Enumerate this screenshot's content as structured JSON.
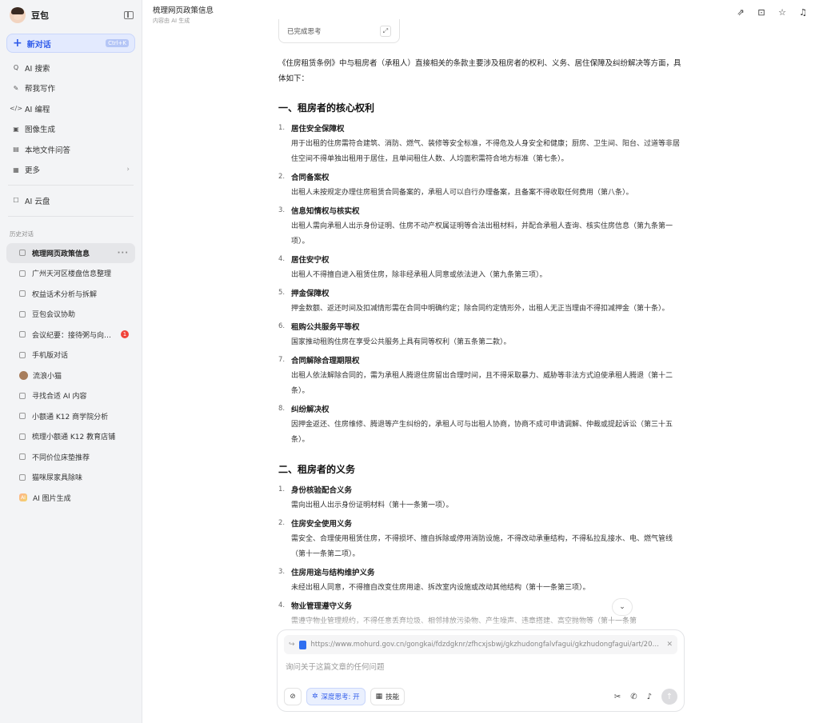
{
  "sidebar": {
    "app_name": "豆包",
    "new_chat": {
      "label": "新对话",
      "shortcut": "Ctrl+K"
    },
    "nav": [
      {
        "icon": "ai-search-icon",
        "glyph": "Q",
        "label": "AI 搜索"
      },
      {
        "icon": "writing-icon",
        "glyph": "✎",
        "label": "帮我写作"
      },
      {
        "icon": "code-icon",
        "glyph": "</>",
        "label": "AI 编程"
      },
      {
        "icon": "image-icon",
        "glyph": "▣",
        "label": "图像生成"
      },
      {
        "icon": "file-qa-icon",
        "glyph": "▤",
        "label": "本地文件问答"
      },
      {
        "icon": "more-grid-icon",
        "glyph": "▦",
        "label": "更多"
      }
    ],
    "cloud": {
      "glyph": "☐",
      "label": "AI 云盘"
    },
    "history_title": "历史对话",
    "history": [
      {
        "label": "梳理网页政策信息",
        "active": true,
        "more": "···"
      },
      {
        "label": "广州天河区楼盘信息整理"
      },
      {
        "label": "权益话术分析与拆解"
      },
      {
        "label": "豆包会议协助"
      },
      {
        "label": "会议纪要：接待粥与向问题...",
        "badge": "1"
      },
      {
        "label": "手机版对话"
      },
      {
        "label": "流浪小猫",
        "avatar": true
      },
      {
        "label": "寻找合适 AI 内容"
      },
      {
        "label": "小额通 K12 商学院分析"
      },
      {
        "label": "梳理小额通 K12 教育店铺"
      },
      {
        "label": "不同价位床垫推荐"
      },
      {
        "label": "猫咪尿家具除味"
      },
      {
        "label": "AI 图片生成",
        "img": true
      }
    ]
  },
  "header": {
    "title": "梳理网页政策信息",
    "subtitle": "内容由 AI 生成",
    "actions": [
      {
        "icon": "share-icon",
        "glyph": "⇗"
      },
      {
        "icon": "save-icon",
        "glyph": "⊡"
      },
      {
        "icon": "star-icon",
        "glyph": "☆"
      },
      {
        "icon": "notification-icon",
        "glyph": "♫"
      }
    ]
  },
  "content": {
    "think_card": {
      "label": "已完成思考",
      "expand_glyph": "⤢"
    },
    "intro": "《住房租赁条例》中与租房者（承租人）直接相关的条款主要涉及租房者的权利、义务、居住保障及纠纷解决等方面，具体如下：",
    "sections": [
      {
        "heading": "一、租房者的核心权利",
        "items": [
          {
            "num": "1.",
            "title": "居住安全保障权",
            "desc": "用于出租的住房需符合建筑、消防、燃气、装修等安全标准，不得危及人身安全和健康；厨房、卫生间、阳台、过道等非居住空间不得单独出租用于居住，且单间租住人数、人均面积需符合地方标准（第七条）。"
          },
          {
            "num": "2.",
            "title": "合同备案权",
            "desc": "出租人未按规定办理住房租赁合同备案的，承租人可以自行办理备案，且备案不得收取任何费用（第八条）。"
          },
          {
            "num": "3.",
            "title": "信息知情权与核实权",
            "desc": "出租人需向承租人出示身份证明、住房不动产权属证明等合法出租材料，并配合承租人查询、核实住房信息（第九条第一项）。"
          },
          {
            "num": "4.",
            "title": "居住安宁权",
            "desc": "出租人不得擅自进入租赁住房，除非经承租人同意或依法进入（第九条第三项）。"
          },
          {
            "num": "5.",
            "title": "押金保障权",
            "desc": "押金数额、返还时间及扣减情形需在合同中明确约定；除合同约定情形外，出租人无正当理由不得扣减押金（第十条）。"
          },
          {
            "num": "6.",
            "title": "租购公共服务平等权",
            "desc": "国家推动租购住房在享受公共服务上具有同等权利（第五条第二款）。"
          },
          {
            "num": "7.",
            "title": "合同解除合理期限权",
            "desc": "出租人依法解除合同的，需为承租人腾退住房留出合理时间，且不得采取暴力、威胁等非法方式迫使承租人腾退（第十二条）。"
          },
          {
            "num": "8.",
            "title": "纠纷解决权",
            "desc": "因押金返还、住房维修、腾退等产生纠纷的，承租人可与出租人协商，协商不成可申请调解、仲裁或提起诉讼（第三十五条）。"
          }
        ]
      },
      {
        "heading": "二、租房者的义务",
        "items": [
          {
            "num": "1.",
            "title": "身份核验配合义务",
            "desc": "需向出租人出示身份证明材料（第十一条第一项）。"
          },
          {
            "num": "2.",
            "title": "住房安全使用义务",
            "desc": "需安全、合理使用租赁住房，不得损坏、擅自拆除或停用消防设施，不得改动承重结构，不得私拉乱接水、电、燃气管线（第十一条第二项）。"
          },
          {
            "num": "3.",
            "title": "住房用途与结构维护义务",
            "desc": "未经出租人同意，不得擅自改变住房用途、拆改室内设施或改动其他结构（第十一条第三项）。"
          },
          {
            "num": "4.",
            "title": "物业管理遵守义务",
            "desc": "需遵守物业管理规约，不得任意丢弃垃圾、相邻排放污染物、产生噪声、违章搭建、高空抛物等（第十一条第"
          }
        ]
      }
    ]
  },
  "composer": {
    "url": "https://www.mohurd.gov.cn/gongkai/fdzdgknr/zfhcxjsbwj/gkzhudongfalvfagui/gkzhudongfagui/art/2025...",
    "placeholder": "询问关于这篇文章的任何问题",
    "deep_think": "深度思考: 开",
    "skills": "技能"
  }
}
